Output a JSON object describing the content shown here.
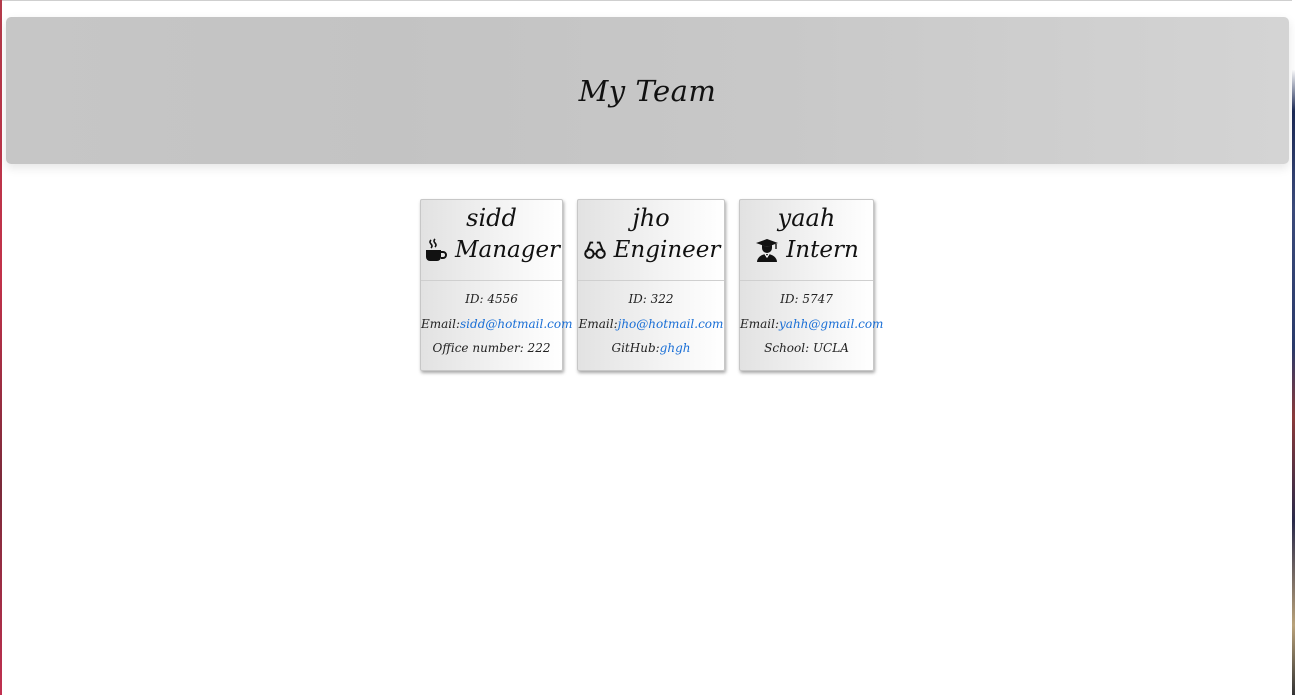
{
  "header": {
    "title": "My Team"
  },
  "team": [
    {
      "name": "sidd",
      "role": "Manager",
      "icon": "coffee-icon",
      "id_label": "ID: 4556",
      "email_prefix": "Email:",
      "email": "sidd@hotmail.com",
      "extra_prefix": "Office number: 222",
      "extra_link": ""
    },
    {
      "name": "jho",
      "role": "Engineer",
      "icon": "glasses-icon",
      "id_label": "ID: 322",
      "email_prefix": "Email:",
      "email": "jho@hotmail.com",
      "extra_prefix": "GitHub:",
      "extra_link": "ghgh"
    },
    {
      "name": "yaah",
      "role": "Intern",
      "icon": "graduate-icon",
      "id_label": "ID: 5747",
      "email_prefix": "Email:",
      "email": "yahh@gmail.com",
      "extra_prefix": "School: UCLA",
      "extra_link": ""
    }
  ],
  "colors": {
    "link": "#1a6fd6",
    "header_bg": "#c6c6c6"
  }
}
